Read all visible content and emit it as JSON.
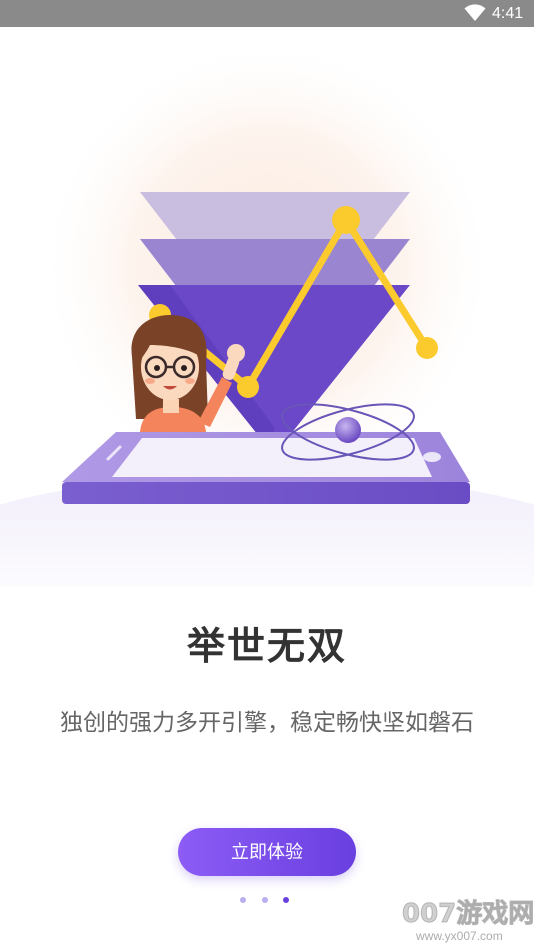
{
  "status_bar": {
    "time": "4:41",
    "wifi_icon": "wifi-icon"
  },
  "onboarding": {
    "title": "举世无双",
    "subtitle": "独创的强力多开引擎，稳定畅快坚如磐石",
    "cta_label": "立即体验",
    "page_indicator": {
      "total": 3,
      "active_index": 2
    }
  },
  "watermark": {
    "brand": "007游戏网",
    "url": "www.yx007.com"
  },
  "colors": {
    "accent_purple": "#7b4fe8",
    "triangle_light": "#c9bde0",
    "triangle_mid": "#9a86d0",
    "triangle_dark": "#6a48c8",
    "chart_line": "#fbcb2e",
    "dot_inactive": "#b9aef0",
    "dot_active": "#6a3fe0",
    "title_text": "#333333",
    "subtitle_text": "#666666"
  }
}
